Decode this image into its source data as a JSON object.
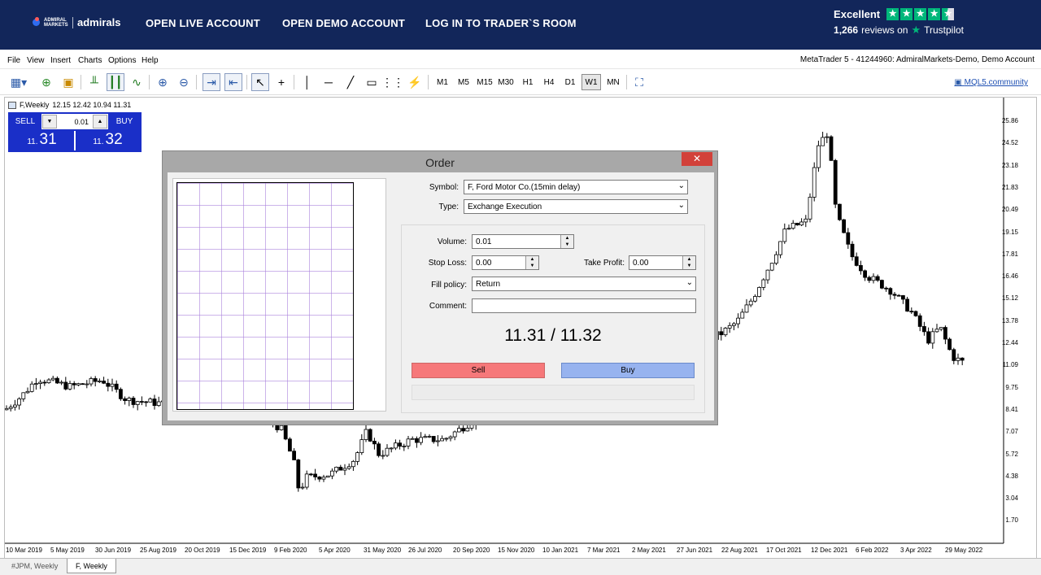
{
  "banner": {
    "brand_small": "ADMIRAL MARKETS",
    "brand_name": "admirals",
    "links": [
      "OPEN LIVE ACCOUNT",
      "OPEN DEMO ACCOUNT",
      "LOG IN TO TRADER`S ROOM"
    ],
    "trustpilot": {
      "rating_word": "Excellent",
      "reviews_count": "1,266",
      "reviews_on": "reviews on",
      "brand": "Trustpilot"
    }
  },
  "menu": {
    "items": [
      "File",
      "View",
      "Insert",
      "Charts",
      "Options",
      "Help"
    ],
    "account_info": "MetaTrader 5 - 41244960: AdmiralMarkets-Demo, Demo Account"
  },
  "toolbar": {
    "timeframes": [
      "M1",
      "M5",
      "M15",
      "M30",
      "H1",
      "H4",
      "D1",
      "W1",
      "MN"
    ],
    "active_timeframe": "W1",
    "community_link": "MQL5.community"
  },
  "chart": {
    "symbol_header": "F,Weekly",
    "ohlc": "12.15 12.42 10.94 11.31",
    "one_click": {
      "sell_label": "SELL",
      "buy_label": "BUY",
      "volume": "0.01",
      "sell_small": "11.",
      "sell_big": "31",
      "buy_small": "11.",
      "buy_big": "32"
    },
    "y_ticks": [
      "25.86",
      "24.52",
      "23.18",
      "21.83",
      "20.49",
      "19.15",
      "17.81",
      "16.46",
      "15.12",
      "13.78",
      "12.44",
      "11.09",
      "9.75",
      "8.41",
      "7.07",
      "5.72",
      "4.38",
      "3.04",
      "1.70"
    ],
    "x_ticks": [
      "10 Mar 2019",
      "5 May 2019",
      "30 Jun 2019",
      "25 Aug 2019",
      "20 Oct 2019",
      "15 Dec 2019",
      "9 Feb 2020",
      "5 Apr 2020",
      "31 May 2020",
      "26 Jul 2020",
      "20 Sep 2020",
      "15 Nov 2020",
      "10 Jan 2021",
      "7 Mar 2021",
      "2 May 2021",
      "27 Jun 2021",
      "22 Aug 2021",
      "17 Oct 2021",
      "12 Dec 2021",
      "6 Feb 2022",
      "3 Apr 2022",
      "29 May 2022"
    ]
  },
  "tabs": {
    "items": [
      "#JPM, Weekly",
      "F, Weekly"
    ],
    "active": "F, Weekly"
  },
  "order_dialog": {
    "title": "Order",
    "close_glyph": "✕",
    "symbol_label": "Symbol:",
    "symbol_value": "F, Ford Motor Co.(15min delay)",
    "type_label": "Type:",
    "type_value": "Exchange Execution",
    "volume_label": "Volume:",
    "volume_value": "0.01",
    "stop_loss_label": "Stop Loss:",
    "stop_loss_value": "0.00",
    "take_profit_label": "Take Profit:",
    "take_profit_value": "0.00",
    "fill_policy_label": "Fill policy:",
    "fill_policy_value": "Return",
    "comment_label": "Comment:",
    "comment_value": "",
    "price_display": "11.31 / 11.32",
    "sell_button": "Sell",
    "buy_button": "Buy"
  },
  "colors": {
    "banner_bg": "#12265a",
    "one_click_bg": "#1a2fc8",
    "sell_button": "#f6787a",
    "buy_button": "#97b3ef",
    "trustpilot_green": "#00b67a",
    "close_button": "#d2413a"
  }
}
